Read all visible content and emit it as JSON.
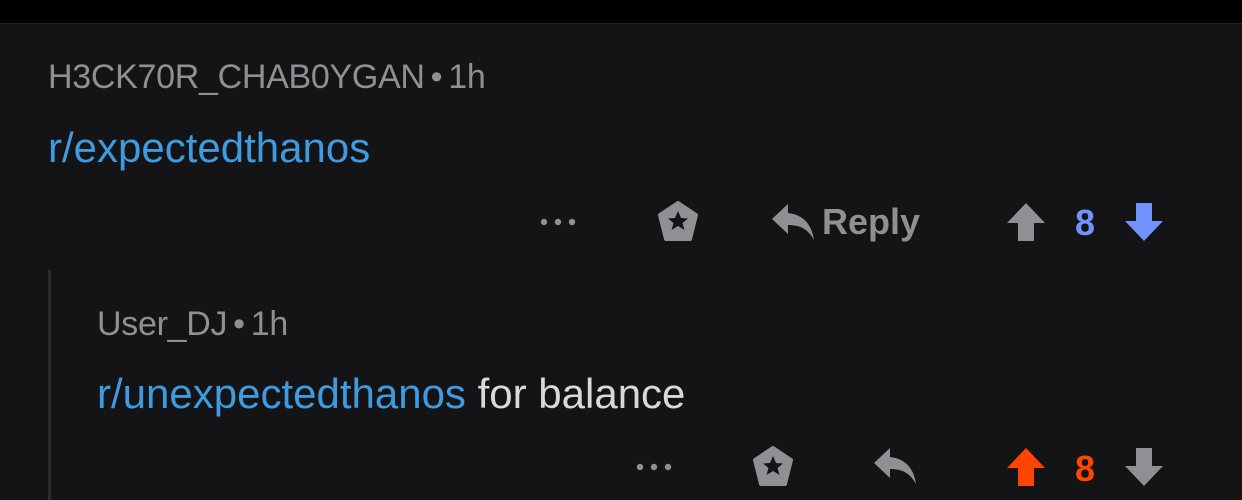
{
  "comments": [
    {
      "author": "H3CK70R_CHAB0YGAN",
      "separator": "•",
      "time": "1h",
      "body_link": "r/expectedthanos",
      "body_text": "",
      "actions": {
        "more_label": "•••",
        "reply_label": "Reply",
        "score": "8"
      },
      "vote_state": "none"
    },
    {
      "author": "User_DJ",
      "separator": "•",
      "time": "1h",
      "body_link": "r/unexpectedthanos",
      "body_text": "for balance",
      "actions": {
        "more_label": "•••",
        "score": "8"
      },
      "vote_state": "upvoted"
    }
  ],
  "colors": {
    "background": "#141417",
    "link": "#3e9bdf",
    "upvote_active": "#ff4500",
    "score_neutral": "#7193ff",
    "icon_gray": "#8f8f94"
  },
  "icons": {
    "more": "more-options-icon",
    "award": "award-icon",
    "reply": "reply-arrow-icon",
    "upvote": "upvote-arrow-icon",
    "downvote": "downvote-arrow-icon"
  }
}
